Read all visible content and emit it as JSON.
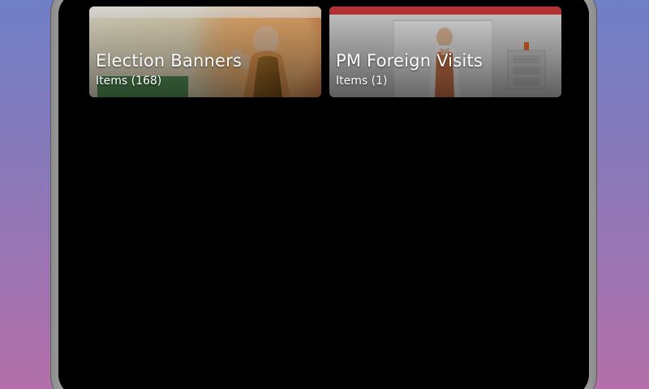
{
  "cards": [
    {
      "title": "Election Banners",
      "subtitle": "Items (168)"
    },
    {
      "title": "PM Foreign Visits",
      "subtitle": "Items (1)"
    }
  ],
  "colors": {
    "background_top": "#6f7fc6",
    "background_bottom": "#b46fa9",
    "screen_bg": "#000000",
    "text": "#ffffff"
  }
}
